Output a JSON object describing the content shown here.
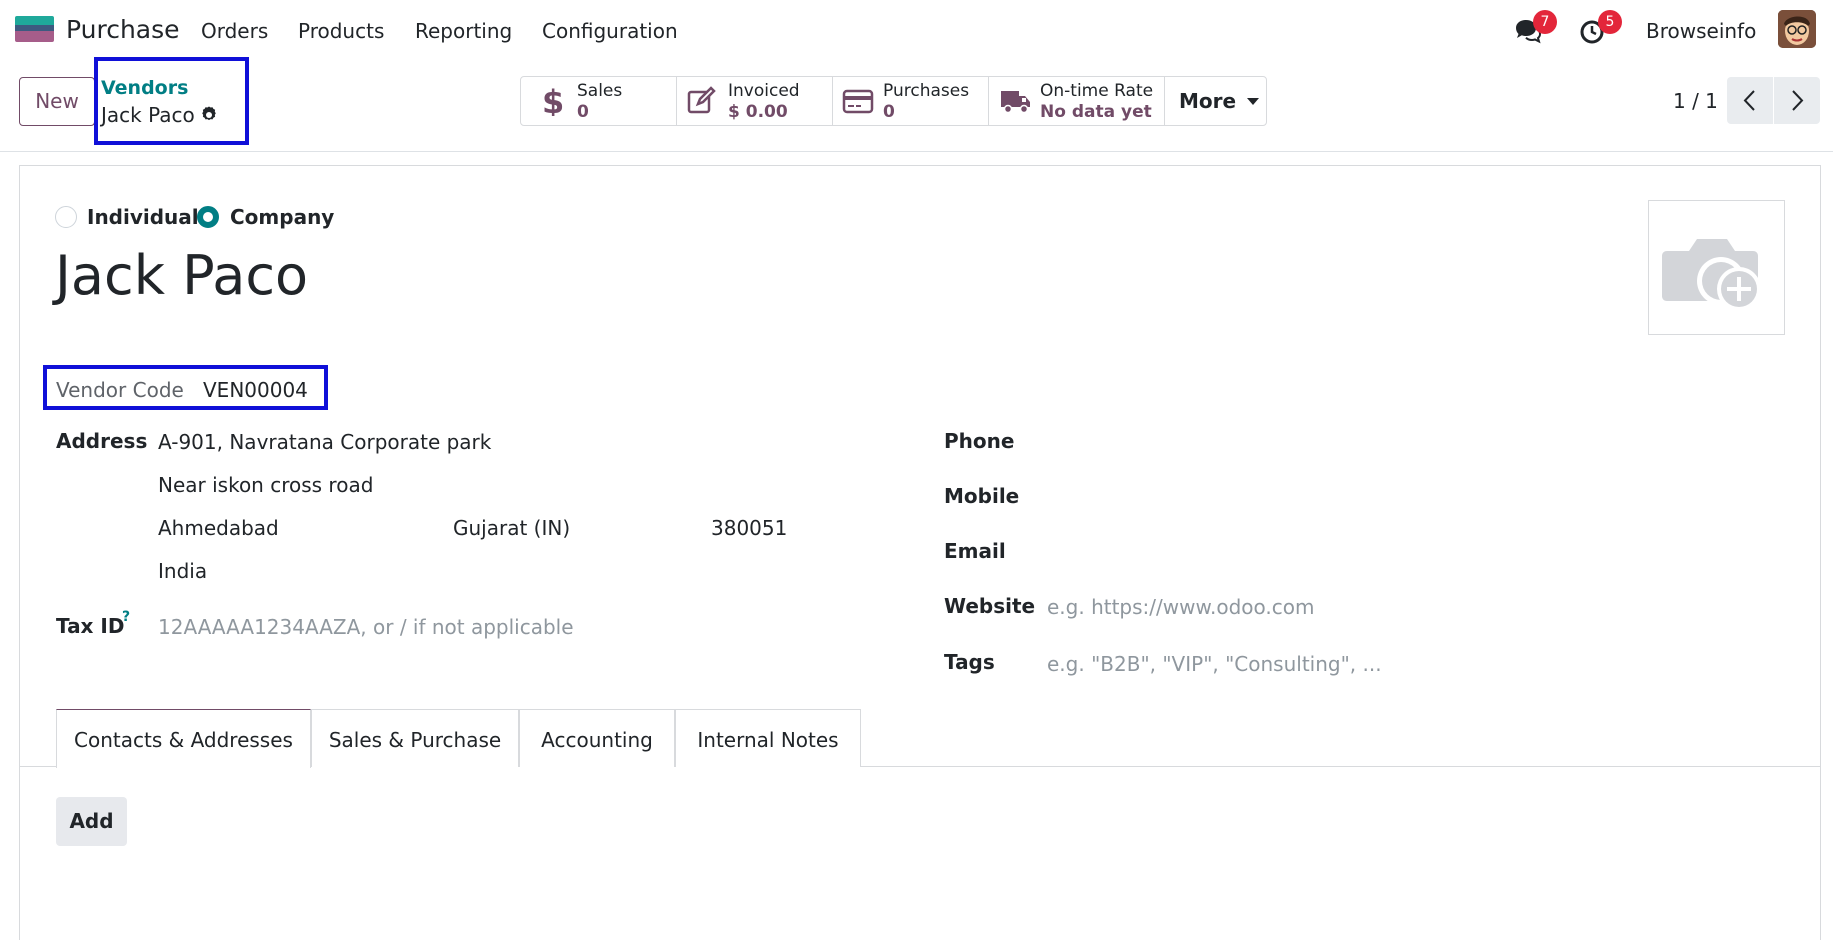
{
  "nav": {
    "app_name": "Purchase",
    "menu": [
      "Orders",
      "Products",
      "Reporting",
      "Configuration"
    ],
    "messages_count": "7",
    "activities_count": "5",
    "user_name": "Browseinfo"
  },
  "control_panel": {
    "new_label": "New",
    "breadcrumb_parent": "Vendors",
    "breadcrumb_current": "Jack Paco",
    "stats": [
      {
        "label": "Sales",
        "value": "0",
        "icon": "dollar-icon"
      },
      {
        "label": "Invoiced",
        "value": "$ 0.00",
        "icon": "pencil-square-icon"
      },
      {
        "label": "Purchases",
        "value": "0",
        "icon": "credit-card-icon"
      },
      {
        "label": "On-time Rate",
        "value": "No data yet",
        "icon": "truck-icon"
      }
    ],
    "more_label": "More",
    "pager": "1 / 1"
  },
  "form": {
    "type_options": [
      "Individual",
      "Company"
    ],
    "type_selected": "Company",
    "name": "Jack Paco",
    "vendor_code_label": "Vendor Code",
    "vendor_code": "VEN00004",
    "address_label": "Address",
    "street": "A-901, Navratana Corporate park",
    "street2": "Near iskon cross road",
    "city": "Ahmedabad",
    "state": "Gujarat (IN)",
    "zip": "380051",
    "country": "India",
    "tax_id_label": "Tax ID",
    "tax_id_help": "?",
    "tax_id_placeholder": "12AAAAA1234AAZA, or / if not applicable",
    "phone_label": "Phone",
    "mobile_label": "Mobile",
    "email_label": "Email",
    "website_label": "Website",
    "website_placeholder": "e.g. https://www.odoo.com",
    "tags_label": "Tags",
    "tags_placeholder": "e.g. \"B2B\", \"VIP\", \"Consulting\", ..."
  },
  "tabs": [
    "Contacts & Addresses",
    "Sales & Purchase",
    "Accounting",
    "Internal Notes"
  ],
  "active_tab": "Contacts & Addresses",
  "add_label": "Add",
  "colors": {
    "brand": "#714b67",
    "accent": "#017e84",
    "highlight": "#1010d8",
    "badge": "#e3263a"
  }
}
